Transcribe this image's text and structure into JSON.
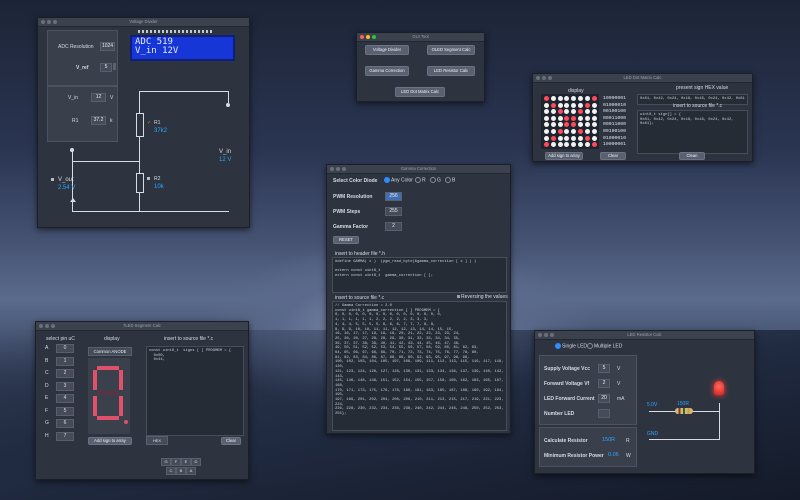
{
  "accent": "#2ea5ff",
  "voltage_divider": {
    "title": "Voltage Divider",
    "adc_label": "ADC Resolution",
    "adc_value": "1024",
    "vref_label": "V_ref",
    "vref_value": "5",
    "lcd_line1": "ADC 519",
    "lcd_line2": "V_in 12V",
    "vin_label": "V_in",
    "vin_value": "12",
    "vin_unit": "V",
    "r1_label": "R1",
    "r1_value": "37.2",
    "r1_unit": "k",
    "r1_circuit_label": "R1",
    "r1_circuit_value": "37k2",
    "r2_circuit_label": "R2",
    "r2_circuit_value": "10k",
    "vin_out_label": "V_in",
    "vin_out_value": "12 V",
    "vout_label": "V_out",
    "vout_value": "2.54 V"
  },
  "gui_tools": {
    "title": "GUI Tool",
    "btn_voltage_divider": "Voltage Divider",
    "btn_oled_calc": "OLED Segment Calc",
    "btn_gamma": "Gamma Correction",
    "btn_led_resistor": "LED Resistor Calc",
    "btn_led_dot": "LED Dot Matrix Calc"
  },
  "led_dot_matrix": {
    "title": "LED Dot Matrix Calc",
    "display_label": "display",
    "hex_label": "present sign HEX value",
    "hex_value": "0x81, 0x42, 0x24, 0x18, 0x18, 0x24, 0x42, 0x81",
    "insert_label": "insert to source file *.c",
    "source_text": "uint8_t sign[] = {\n0x81, 0x42, 0x24, 0x18, 0x18, 0x24, 0x42, 0x81};",
    "rows": [
      "10000001",
      "01000010",
      "00100100",
      "00011000",
      "00011000",
      "00100100",
      "01000010",
      "10000001"
    ],
    "btn_add": "Add sign to array",
    "btn_clear": "Clear",
    "btn_clean": "Clean"
  },
  "gamma": {
    "title": "Gamma Correction",
    "diode_label": "Select Color Diode",
    "diode_options": [
      "Any Color",
      "R",
      "G",
      "B"
    ],
    "pwm_res_label": "PWM Resolution",
    "pwm_res_value": "256",
    "pwm_steps_label": "PWM Steps",
    "pwm_steps_value": "255",
    "gamma_label": "Gamma Factor",
    "gamma_value": "2",
    "btn_reset": "RESET",
    "header_label": "insert to header file *.h",
    "header_code": "#define GAMMA( x )  (pgm_read_byte(&gamma_correction [ x ] ) )\n\nextern const uint8_t\nextern const uint8_t  gamma_correction [ ];",
    "source_label": "insert to source file *.c",
    "reverse_label": "Reversing the values",
    "source_code": "// Gamma Correction = 2.0\nconst uint8_t gamma_correction [ ] PROGMEM = {\n0, 0, 0, 0, 0, 0, 0, 0, 0, 0, 0, 0, 0, 0, 0, 0,\n1, 1, 1, 1, 1, 1, 2, 2, 2, 2, 2, 3, 3, 3,\n4, 4, 4, 5, 5, 5, 5, 6, 6, 6, 7, 7, 7, 8, 8,\n8, 9, 9, 10, 10, 11, 11, 12, 12, 13, 14, 14, 15, 15,\n16, 16, 17, 17, 18, 19, 19, 20, 21, 22, 22, 23, 23, 24,\n25, 26, 26, 27, 28, 28, 29, 30, 31, 32, 33, 34, 34, 35,\n36, 37, 37, 38, 39, 40, 41, 42, 43, 44, 45, 46, 47, 48,\n49, 50, 51, 52, 52, 53, 54, 55, 56, 57, 58, 59, 60, 61, 62, 63,\n64, 65, 66, 67, 68, 69, 70, 71, 72, 73, 74, 75, 76, 77, 78, 80,\n81, 82, 83, 84, 86, 87, 88, 89, 90, 92, 93, 95, 97, 98, 99,\n100, 102, 103, 104, 105, 107, 108, 109, 111, 112, 113, 115, 116, 117, 118, 120,\n121, 123, 124, 126, 127, 128, 130, 131, 133, 134, 136, 137, 139, 140, 142, 143,\n145, 146, 148, 149, 151, 152, 154, 155, 157, 158, 160, 162, 163, 165, 167, 168,\n170, 171, 173, 175, 176, 178, 180, 181, 183, 185, 187, 188, 190, 192, 194, 195,\n197, 199, 201, 202, 204, 206, 208, 210, 211, 213, 215, 217, 219, 221, 223, 224,\n226, 228, 230, 232, 234, 236, 238, 240, 242, 244, 246, 248, 250, 252, 253, 255};"
  },
  "seven_seg": {
    "title": "7LED Segment Calc",
    "pin_label": "select pin uC",
    "display_label": "display",
    "source_label": "insert to source file *.c",
    "pins": [
      {
        "letter": "A",
        "value": "0"
      },
      {
        "letter": "B",
        "value": "1"
      },
      {
        "letter": "C",
        "value": "2"
      },
      {
        "letter": "D",
        "value": "3"
      },
      {
        "letter": "E",
        "value": "4"
      },
      {
        "letter": "F",
        "value": "5"
      },
      {
        "letter": "G",
        "value": "6"
      },
      {
        "letter": "H",
        "value": "7"
      }
    ],
    "type_value": "Common ANODE",
    "source_text": "const uint8_t  signs [ ] PROGMEM = {\n  0x00,\n  0x44,",
    "btn_add": "Add sign to array",
    "hex_value": "HEX",
    "btn_clear": "Clear",
    "segment_letters": [
      "G",
      "F",
      "E",
      "D",
      "C",
      "B",
      "A"
    ]
  },
  "led_resistor": {
    "title": "LED Resistor Calc",
    "single_label": "Single LED",
    "multiple_label": "Multiple LED",
    "supply_label": "Supply Voltage Vcc",
    "supply_value": "5",
    "supply_unit": "V",
    "forward_v_label": "Forward Voltage Vf",
    "forward_v_value": "2",
    "forward_v_unit": "V",
    "forward_c_label": "LED Forward Current",
    "forward_c_value": "20",
    "forward_c_unit": "mA",
    "number_label": "Number LED",
    "number_value": "",
    "calc_label": "Calculate Resistor",
    "calc_value": "150R",
    "calc_unit": "R",
    "power_label": "Minimum Resistor Power",
    "power_value": "0.06",
    "power_unit": "W",
    "circuit_v": "5.0V",
    "circuit_r": "150R",
    "circuit_gnd": "GND"
  }
}
